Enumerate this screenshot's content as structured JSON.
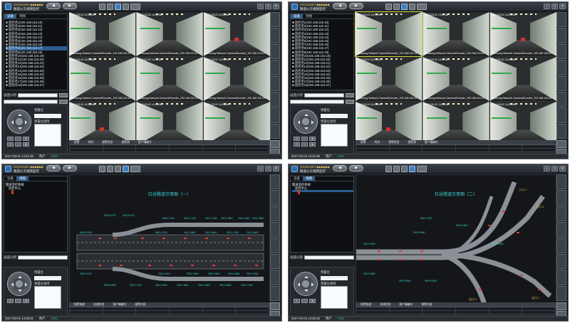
{
  "app": {
    "brand": "ZHONGWEI ◆◆◆◆◆◆",
    "title": "隧道火灾视频监控",
    "win_min": "–",
    "win_max": "□",
    "win_close": "✕"
  },
  "nav": [
    "◀",
    "▶"
  ],
  "tabs": {
    "devices": "设备",
    "map": "地图"
  },
  "tree_root": "隧道监控系统",
  "tree_center": "监控中心",
  "cameras": [
    "■ 监控点1(192.168.115.10)",
    "■ 监控点2(192.168.115.11)",
    "■ 监控点3(192.168.115.12)",
    "■ 监控点4(192.168.115.13)",
    "■ 监控点5(192.168.115.14)",
    "■ 监控点6(192.168.115.15)",
    "■ 监控点7(192.168.115.16)",
    "■ 监控点8(192.168.115.17)",
    "■ 监控点9(192.168.115.18)",
    "■ 监控点10(192.168.115.19)",
    "■ 监控点11(192.168.115.20)",
    "■ 监控点12(192.168.115.21)",
    "■ 监控点13(192.168.115.22)",
    "■ 监控点14(192.168.115.23)",
    "■ 监控点15(192.168.115.24)",
    "■ 监控点16(192.168.115.25)",
    "■ 监控点17(192.168.115.26)",
    "■ 监控点18(192.168.115.27)"
  ],
  "controls": {
    "split_label": "画面分割",
    "preset_label": "预置位",
    "preset_call": "预置位调用",
    "ptz_buttons": [
      "+",
      "-",
      "●",
      "+",
      "-",
      "●"
    ]
  },
  "status": {
    "datetime_tl": "2017-03-01  14:21:56",
    "datetime_tr": "2017-03-01  14:21:56",
    "datetime_bl": "2017-03-01  14:25:01",
    "datetime_br": "2017-03-01  14:25:16",
    "user": "用户",
    "link": "VMS",
    "online": "在线"
  },
  "alarm_headers": [
    "报警",
    "时间",
    "报警类型",
    "报警源",
    "报警描述",
    "处理状态",
    "客户端编号",
    "报警内容"
  ],
  "feeds_tl": [
    {
      "stamp": "2017-03-01 14:21:56",
      "caption": "Samsung Network Camera/Encoder_192.168.115.10"
    },
    {
      "stamp": "2017-03-01 14:21:56",
      "caption": "Samsung Network Camera/Encoder_192.168.115.11"
    },
    {
      "stamp": "2017-03-01 14:21:56",
      "caption": "Samsung Network Camera/Encoder_192.168.115.12"
    },
    {
      "stamp": "2017-03-01 14:21:56",
      "caption": "Samsung Network Camera/Encoder_192.168.115.13"
    },
    {
      "stamp": "2017-03-01 14:21:56",
      "caption": "Samsung Network Camera/Encoder_192.168.115.14"
    },
    {
      "stamp": "2017-03-01 14:21:56",
      "caption": "Samsung Network Camera/Encoder_192.168.115.15"
    },
    {
      "stamp": "2017-03-01 14:21:56",
      "caption": "Samsung Network Camera/Encoder_192.168.115.16"
    },
    {
      "stamp": "2017-03-01 14:21:56",
      "caption": "Samsung Network Camera/Encoder_192.168.115.17"
    },
    {
      "stamp": "2017-03-01 14:21:56",
      "caption": "Samsung Network Camera/Encoder_192.168.115.18"
    }
  ],
  "feeds_tr": [
    {
      "stamp": "2017-03-01 14:21:56",
      "caption": "Samsung Network Camera/Encoder_192.168.115.19"
    },
    {
      "stamp": "2017-03-01 14:21:56",
      "caption": "Samsung Network Camera/Encoder_192.168.115.20"
    },
    {
      "stamp": "2017-03-01 14:21:56",
      "caption": "Samsung Network Camera/Encoder_192.168.115.21"
    },
    {
      "stamp": "2017-03-01 14:21:56",
      "caption": "Samsung Network Camera/Encoder_192.168.115.22"
    },
    {
      "stamp": "2017-03-01 14:21:56",
      "caption": "Samsung Network Camera/Encoder_192.168.115.23"
    },
    {
      "stamp": "2017-03-01 14:21:56",
      "caption": "Samsung Network Camera/Encoder_192.168.115.24"
    },
    {
      "stamp": "2017-03-01 14:21:56",
      "caption": "Samsung Network Camera/Encoder_192.168.115.25"
    },
    {
      "stamp": "2017-03-01 14:21:56",
      "caption": "Samsung Network Camera/Encoder_192.168.115.26"
    },
    {
      "stamp": "2017-03-01 14:21:56",
      "caption": "Samsung Network Camera/Encoder_192.168.115.27"
    }
  ],
  "map1": {
    "title": "红谷隧道示意图（一）",
    "stakes_top": [
      "SK0+070",
      "SK0+070",
      "NK1+100",
      "NK1+100",
      "SK1+160",
      "SK1+360",
      "SK1+460",
      "SK1+560"
    ],
    "stakes_mid": [
      "NK0+920",
      "NK1+220",
      "SK1+560",
      "SK1+660",
      "SK1+760",
      "SK1+880"
    ],
    "stakes_bot": [
      "SK0+920",
      "SK1+160",
      "SK1+360",
      "SK1+560",
      "SK1+660",
      "SK1+760"
    ],
    "stakes_lowest": [
      "SK0+900",
      "SK1+100",
      "SK1+260",
      "SK1+360",
      "SK1+560",
      "SK1+660",
      "SK1+760"
    ]
  },
  "map2": {
    "title": "红谷隧道示意图（二）",
    "stakes": [
      "SK2+750",
      "SK2+550",
      "SK2+650",
      "SK2+850",
      "SK2+950",
      "NK3+050",
      "SK2+350",
      "SK2+450"
    ],
    "exits": [
      "入口 1",
      "入口 2",
      "出口 1",
      "出口 2"
    ]
  }
}
